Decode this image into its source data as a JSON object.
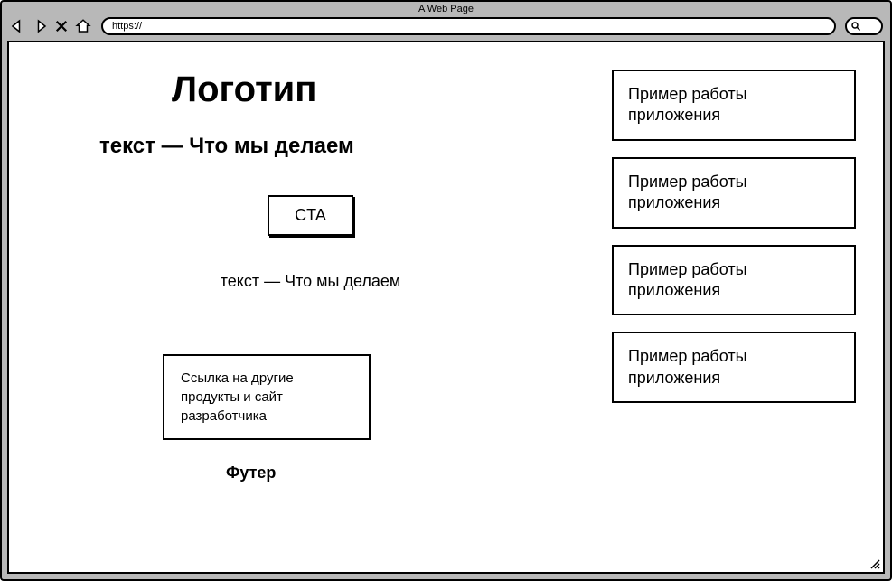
{
  "window": {
    "title": "A Web Page",
    "url": "https://"
  },
  "main": {
    "logo": "Логотип",
    "tagline": "текст — Что мы делаем",
    "cta_label": "CTA",
    "subtext": "текст — Что мы делаем",
    "link_box": "Ссылка на другие продукты и сайт разработчика",
    "footer": "Футер"
  },
  "sidebar": {
    "examples": [
      "Пример работы приложения",
      "Пример работы приложения",
      "Пример работы приложения",
      "Пример работы приложения"
    ]
  }
}
